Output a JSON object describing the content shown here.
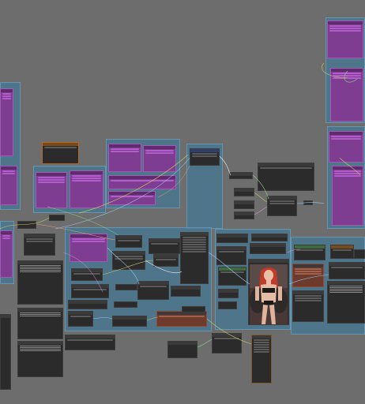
{
  "app": {
    "title": "",
    "background_color": "#6d6d6d",
    "group_color": "#4a7896",
    "wire_colors": [
      "#c8c864",
      "#9ac8f0",
      "#e0a070",
      "#8cd08c",
      "#d890d8",
      "#f0f0f0"
    ]
  },
  "nodes": {
    "note_orange": "",
    "preview_image": "woman-portrait-preview"
  }
}
